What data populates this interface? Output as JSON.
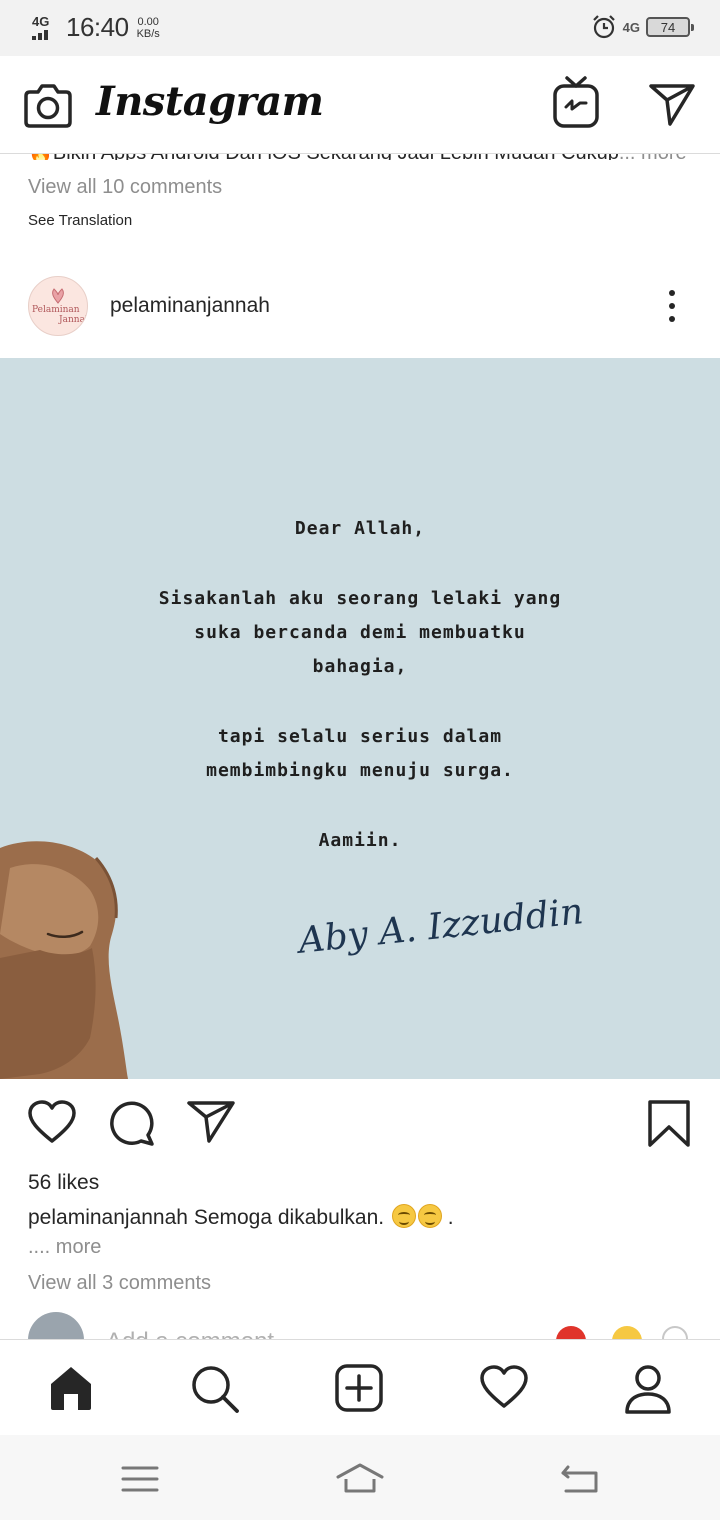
{
  "status_bar": {
    "network_left": "4G",
    "time": "16:40",
    "speed_value": "0.00",
    "speed_unit": "KB/s",
    "network_right": "4G",
    "battery": "74"
  },
  "header": {
    "logo": "Instagram",
    "icons": [
      "camera-icon",
      "igtv-icon",
      "direct-message-icon"
    ]
  },
  "previous_post": {
    "caption_partial": "🔥Bikin Apps Android Dan iOS Sekarang Jadi Lebih Mudah Cukup",
    "caption_more": "... more",
    "view_comments": "View all 10 comments",
    "see_translation": "See Translation"
  },
  "post": {
    "username": "pelaminanjannah",
    "avatar_text_1": "Pelaminan",
    "avatar_text_2": "Jannah",
    "image_text": {
      "line1": "Dear Allah,",
      "line2": "Sisakanlah aku seorang lelaki yang",
      "line3": "suka bercanda demi membuatku",
      "line4": "bahagia,",
      "line5": "tapi selalu serius dalam",
      "line6": "membimbingku menuju surga.",
      "line7": "Aamiin.",
      "signature": "Aby A. Izzuddin"
    },
    "likes": "56 likes",
    "caption_user": "pelaminanjannah",
    "caption_text": "Semoga dikabulkan.",
    "caption_end": ".",
    "more": ".... more",
    "view_comments": "View all 3 comments",
    "add_comment_placeholder": "Add a comment..."
  },
  "bottom_nav": [
    "home-icon",
    "search-icon",
    "new-post-icon",
    "activity-icon",
    "profile-icon"
  ],
  "system_nav": [
    "menu-icon",
    "home-icon",
    "back-icon"
  ]
}
